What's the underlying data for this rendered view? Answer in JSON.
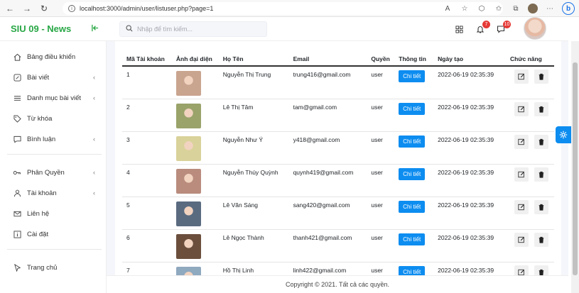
{
  "browser": {
    "url": "localhost:3000/admin/user/listuser.php?page=1",
    "text_size_icon": "A",
    "bing_label": "b"
  },
  "header": {
    "brand": "SIU 09 - News",
    "search_placeholder": "Nhập để tìm kiếm...",
    "notifications_count": "7",
    "messages_count": "10"
  },
  "sidebar": {
    "items": [
      {
        "label": "Bảng điều khiển",
        "icon": "home-icon",
        "chevron": false
      },
      {
        "label": "Bài viết",
        "icon": "edit-icon",
        "chevron": true
      },
      {
        "label": "Danh mục bài viết",
        "icon": "list-icon",
        "chevron": true
      },
      {
        "label": "Từ khóa",
        "icon": "tag-icon",
        "chevron": false
      },
      {
        "label": "Bình luận",
        "icon": "comment-icon",
        "chevron": true
      },
      {
        "label": "Phân Quyền",
        "icon": "key-icon",
        "chevron": true
      },
      {
        "label": "Tài khoản",
        "icon": "user-icon",
        "chevron": true
      },
      {
        "label": "Liên hệ",
        "icon": "mail-icon",
        "chevron": false
      },
      {
        "label": "Cài đặt",
        "icon": "info-icon",
        "chevron": false
      },
      {
        "label": "Trang chủ",
        "icon": "cursor-icon",
        "chevron": false
      }
    ]
  },
  "table": {
    "columns": [
      "Mã Tài khoản",
      "Ảnh đại diện",
      "Họ Tên",
      "Email",
      "Quyền",
      "Thông tin",
      "Ngày tạo",
      "Chức năng"
    ],
    "detail_label": "Chi tiết",
    "rows": [
      {
        "id": "1",
        "name": "Nguyễn Thị Trung",
        "email": "trung416@gmail.com",
        "role": "user",
        "created": "2022-06-19 02:35:39",
        "avatar_color": "#c9a48f"
      },
      {
        "id": "2",
        "name": "Lê Thị Tâm",
        "email": "tam@gmail.com",
        "role": "user",
        "created": "2022-06-19 02:35:39",
        "avatar_color": "#9aa36a"
      },
      {
        "id": "3",
        "name": "Nguyễn Như Ý",
        "email": "y418@gmail.com",
        "role": "user",
        "created": "2022-06-19 02:35:39",
        "avatar_color": "#d9d29a"
      },
      {
        "id": "4",
        "name": "Nguyễn Thúy Quỳnh",
        "email": "quynh419@gmail.com",
        "role": "user",
        "created": "2022-06-19 02:35:39",
        "avatar_color": "#b98c7e"
      },
      {
        "id": "5",
        "name": "Lê Văn Sáng",
        "email": "sang420@gmail.com",
        "role": "user",
        "created": "2022-06-19 02:35:39",
        "avatar_color": "#5a6b80"
      },
      {
        "id": "6",
        "name": "Lê Ngọc Thành",
        "email": "thanh421@gmail.com",
        "role": "user",
        "created": "2022-06-19 02:35:39",
        "avatar_color": "#6b4f3c"
      },
      {
        "id": "7",
        "name": "Hồ Thị Linh",
        "email": "linh422@gmail.com",
        "role": "user",
        "created": "2022-06-19 02:35:39",
        "avatar_color": "#8fa9bf"
      }
    ]
  },
  "footer": {
    "text": "Copyright © 2021. Tất cả các quyền."
  },
  "colors": {
    "brand": "#28a745",
    "primary_button": "#0d8df0",
    "badge": "#e53935"
  }
}
